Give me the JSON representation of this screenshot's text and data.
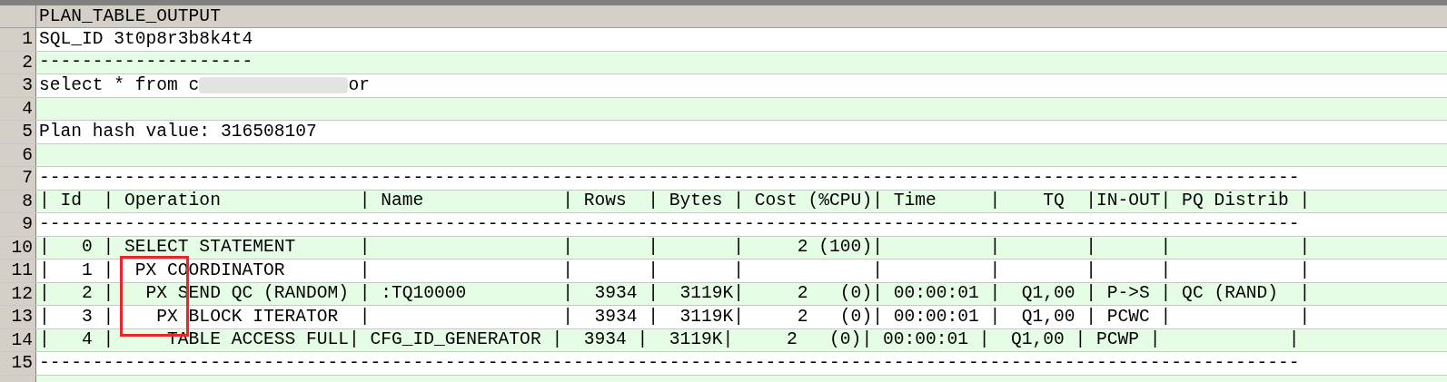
{
  "grid": {
    "column_header": "PLAN_TABLE_OUTPUT",
    "rows": [
      {
        "number": "1",
        "text": "SQL_ID 3t0p8r3b8k4t4"
      },
      {
        "number": "2",
        "text": "--------------------"
      },
      {
        "number": "3",
        "text": "select * from c",
        "redacted": true,
        "text_after": "or"
      },
      {
        "number": "4",
        "text": ""
      },
      {
        "number": "5",
        "text": "Plan hash value: 316508107"
      },
      {
        "number": "6",
        "text": ""
      },
      {
        "number": "7",
        "text": "----------------------------------------------------------------------------------------------------------------------"
      },
      {
        "number": "8",
        "text": "| Id  | Operation             | Name             | Rows  | Bytes | Cost (%CPU)| Time     |    TQ  |IN-OUT| PQ Distrib |"
      },
      {
        "number": "9",
        "text": "----------------------------------------------------------------------------------------------------------------------"
      },
      {
        "number": "10",
        "text": "|   0 | SELECT STATEMENT      |                  |       |       |     2 (100)|          |        |      |            |"
      },
      {
        "number": "11",
        "text": "|   1 |  PX COORDINATOR       |                  |       |       |            |          |        |      |            |"
      },
      {
        "number": "12",
        "text": "|   2 |   PX SEND QC (RANDOM) | :TQ10000         |  3934 |  3119K|     2   (0)| 00:00:01 |  Q1,00 | P->S | QC (RAND)  |"
      },
      {
        "number": "13",
        "text": "|   3 |    PX BLOCK ITERATOR  |                  |  3934 |  3119K|     2   (0)| 00:00:01 |  Q1,00 | PCWC |            |"
      },
      {
        "number": "14",
        "text": "|   4 |     TABLE ACCESS FULL| CFG_ID_GENERATOR |  3934 |  3119K|     2   (0)| 00:00:01 |  Q1,00 | PCWP |            |"
      },
      {
        "number": "15",
        "text": "----------------------------------------------------------------------------------------------------------------------"
      }
    ]
  }
}
